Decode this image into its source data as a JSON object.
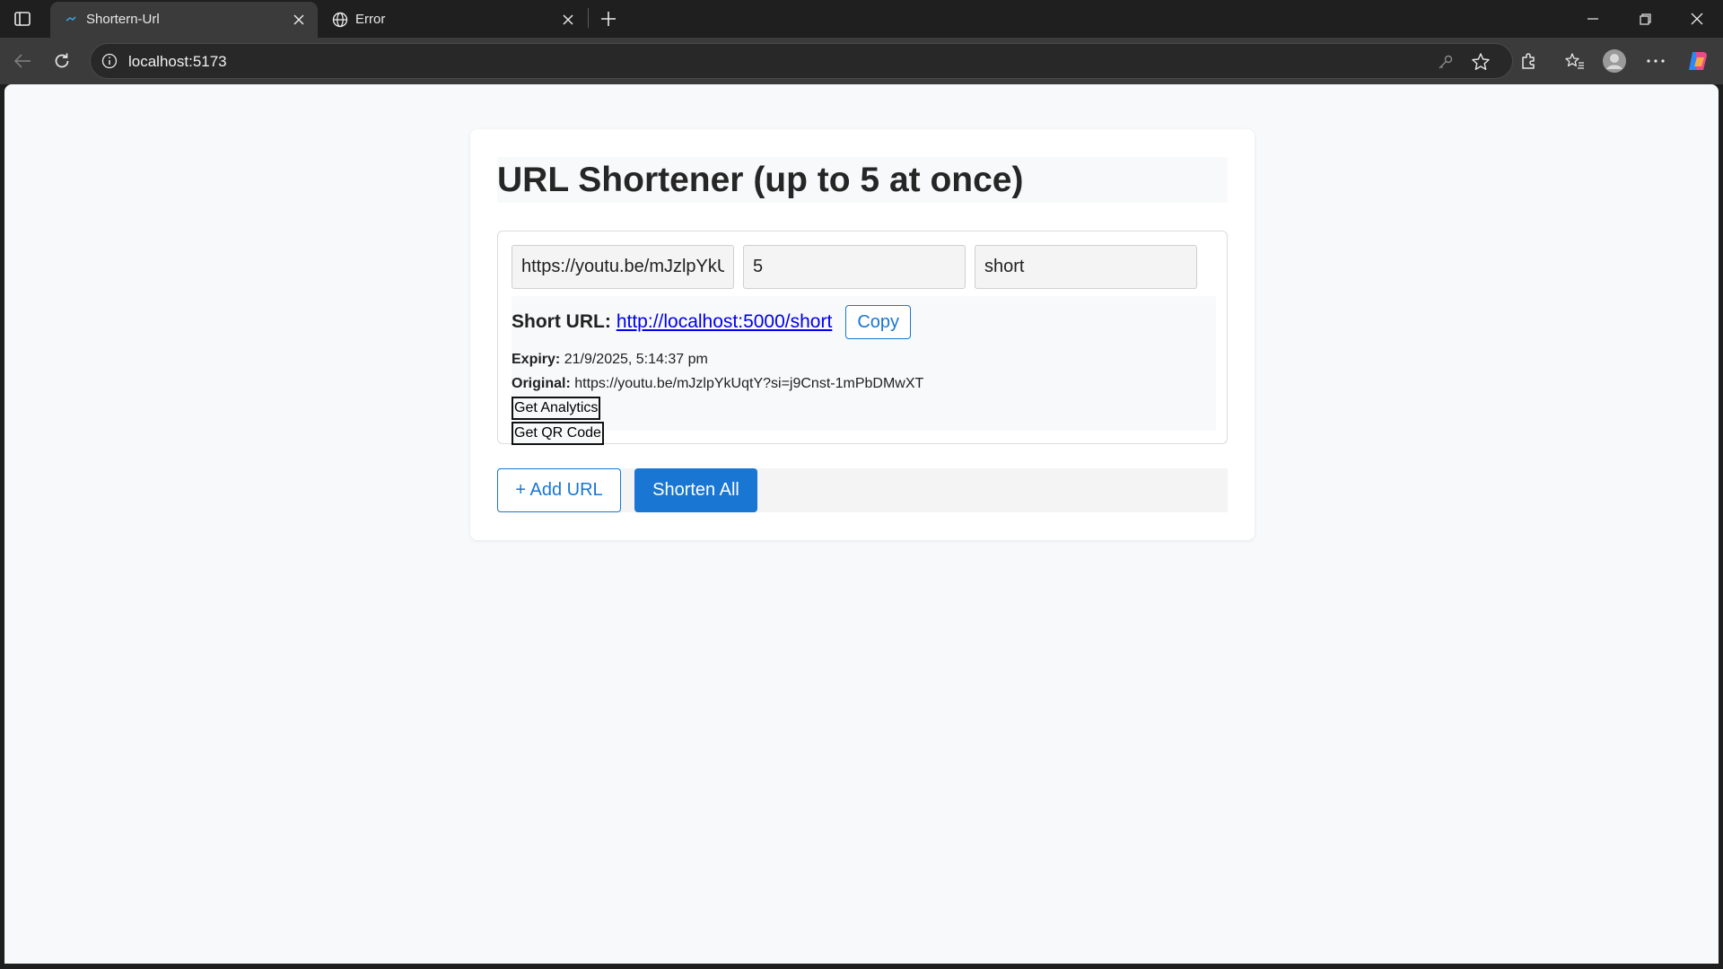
{
  "browser": {
    "tabs": [
      {
        "title": "Shortern-Url",
        "active": true
      },
      {
        "title": "Error",
        "active": false
      }
    ],
    "address": "localhost:5173"
  },
  "app": {
    "title": "URL Shortener (up to 5 at once)",
    "entry": {
      "url_value": "https://youtu.be/mJzlpYkUqtY?si=j9Cnst-1mPbDMwXT",
      "expiry_value": "5",
      "code_value": "short"
    },
    "result": {
      "short_label": "Short URL:",
      "short_url": "http://localhost:5000/short",
      "copy_label": "Copy",
      "expiry_label": "Expiry:",
      "expiry_value": "21/9/2025, 5:14:37 pm",
      "original_label": "Original:",
      "original_value": "https://youtu.be/mJzlpYkUqtY?si=j9Cnst-1mPbDMwXT",
      "analytics_label": "Get Analytics",
      "qr_label": "Get QR Code"
    },
    "actions": {
      "add_label": "+ Add URL",
      "shorten_label": "Shorten All"
    }
  },
  "colors": {
    "primary": "#1976d2",
    "link": "#0000ee",
    "page_bg": "#f8f9fa",
    "chrome_bg": "#1f1f1f"
  }
}
